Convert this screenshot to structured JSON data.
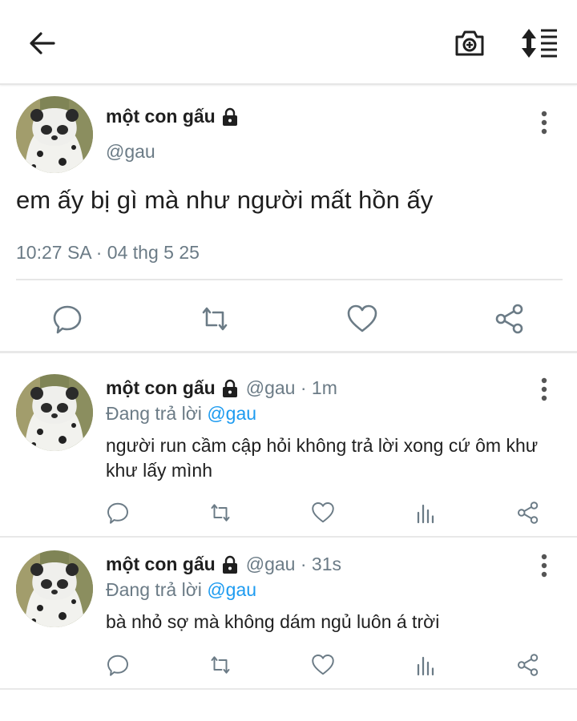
{
  "header": {
    "back_icon": "arrow-left-icon",
    "camera_icon": "camera-plus-icon",
    "sort_icon": "sort-list-icon"
  },
  "main_tweet": {
    "author_name": "một con gấu",
    "handle": "@gau",
    "text": "em ấy bị gì mà như người mất hồn ấy",
    "timestamp": "10:27 SA · 04 thg 5 25",
    "actions": [
      "reply-icon",
      "retweet-icon",
      "like-icon",
      "share-icon"
    ]
  },
  "replies": [
    {
      "author_name": "một con gấu",
      "meta": "@gau · 1m",
      "replying_label": "Đang trả lời",
      "replying_to": "@gau",
      "text": "người run cầm cập hỏi không trả lời xong cứ ôm khư khư lấy mình"
    },
    {
      "author_name": "một con gấu",
      "meta": "@gau · 31s",
      "replying_label": "Đang trả lời",
      "replying_to": "@gau",
      "text": "bà nhỏ sợ mà không dám ngủ luôn á trời"
    }
  ],
  "colors": {
    "text": "#1f1f1f",
    "secondary": "#6b7b86",
    "mention": "#1d9bf0",
    "divider": "#e6e6e6"
  }
}
